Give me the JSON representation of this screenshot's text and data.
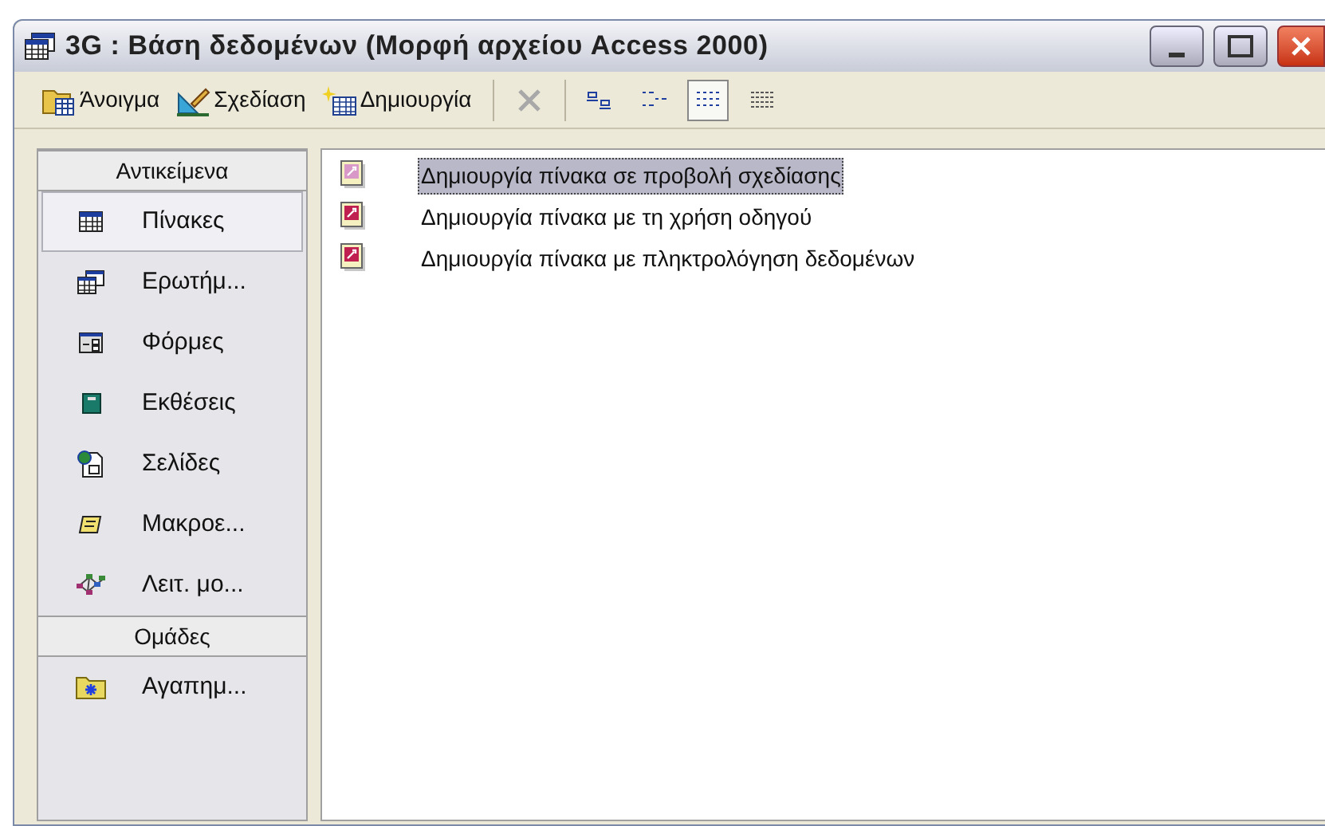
{
  "window": {
    "title": "3G : Βάση δεδομένων (Μορφή αρχείου Access 2000)"
  },
  "toolbar": {
    "buttons": [
      {
        "kind": "open",
        "label": "Άνοιγμα"
      },
      {
        "kind": "design",
        "label": "Σχεδίαση"
      },
      {
        "kind": "new",
        "label": "Δημιουργία"
      }
    ],
    "delete": {
      "disabled": true
    },
    "views": [
      {
        "kind": "large",
        "selected": false
      },
      {
        "kind": "small",
        "selected": false
      },
      {
        "kind": "list",
        "selected": true
      },
      {
        "kind": "details",
        "selected": false
      }
    ]
  },
  "sidebar": {
    "sections": [
      {
        "title": "Αντικείμενα",
        "items": [
          {
            "kind": "tables",
            "label": "Πίνακες",
            "selected": true
          },
          {
            "kind": "queries",
            "label": "Ερωτήμ...",
            "selected": false
          },
          {
            "kind": "forms",
            "label": "Φόρμες",
            "selected": false
          },
          {
            "kind": "reports",
            "label": "Εκθέσεις",
            "selected": false
          },
          {
            "kind": "pages",
            "label": "Σελίδες",
            "selected": false
          },
          {
            "kind": "macros",
            "label": "Μακροε...",
            "selected": false
          },
          {
            "kind": "modules",
            "label": "Λειτ. μο...",
            "selected": false
          }
        ]
      },
      {
        "title": "Ομάδες",
        "items": [
          {
            "kind": "favorites",
            "label": "Αγαπημ...",
            "selected": false
          }
        ]
      }
    ]
  },
  "list": [
    {
      "label": "Δημιουργία πίνακα σε προβολή σχεδίασης",
      "selected": true
    },
    {
      "label": "Δημιουργία πίνακα με τη χρήση οδηγού",
      "selected": false
    },
    {
      "label": "Δημιουργία πίνακα με πληκτρολόγηση δεδομένων",
      "selected": false
    }
  ]
}
